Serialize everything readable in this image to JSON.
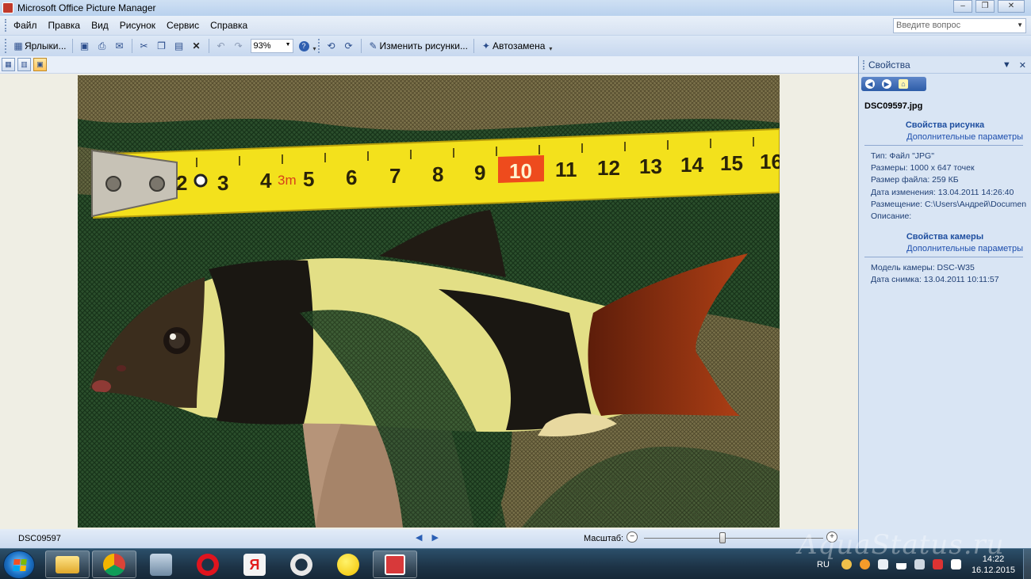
{
  "window": {
    "title": "Microsoft Office Picture Manager",
    "controls": [
      "–",
      "❐",
      "✕"
    ]
  },
  "menu": {
    "items": [
      "Файл",
      "Правка",
      "Вид",
      "Рисунок",
      "Сервис",
      "Справка"
    ],
    "ask_placeholder": "Введите вопрос"
  },
  "toolbar": {
    "shortcuts_label": "Ярлыки...",
    "zoom_value": "93%",
    "edit_pictures_label": "Изменить рисунки...",
    "autocorrect_label": "Автозамена"
  },
  "status": {
    "file_name": "DSC09597",
    "zoom_label": "Масштаб:",
    "zoom_level": 0.44
  },
  "pane": {
    "title": "Свойства",
    "file_name": "DSC09597.jpg",
    "picture_section": "Свойства рисунка",
    "picture_advanced": "Дополнительные параметры",
    "picture_props": [
      "Тип: Файл \"JPG\"",
      "Размеры: 1000 x 647 точек",
      "Размер файла: 259 КБ",
      "Дата изменения: 13.04.2011 14:26:40",
      "Размещение:   C:\\Users\\Андрей\\Documen",
      "Описание:"
    ],
    "camera_section": "Свойства камеры",
    "camera_advanced": "Дополнительные параметры",
    "camera_props": [
      "Модель камеры: DSC-W35",
      "Дата снимка: 13.04.2011 10:11:57"
    ]
  },
  "photo": {
    "tape_numbers": [
      "2",
      "3",
      "4",
      "5",
      "6",
      "7",
      "8",
      "9",
      "10",
      "11",
      "12",
      "13",
      "14",
      "15",
      "16"
    ],
    "tape_marker": "3m"
  },
  "taskbar": {
    "language": "RU",
    "time": "14:22",
    "date": "16.12.2015"
  },
  "watermark": "AquaStatus.ru",
  "colors": {
    "accent": "#1f4fa0",
    "tape": "#f3e11c",
    "tape_highlight": "#ee4b1d"
  }
}
